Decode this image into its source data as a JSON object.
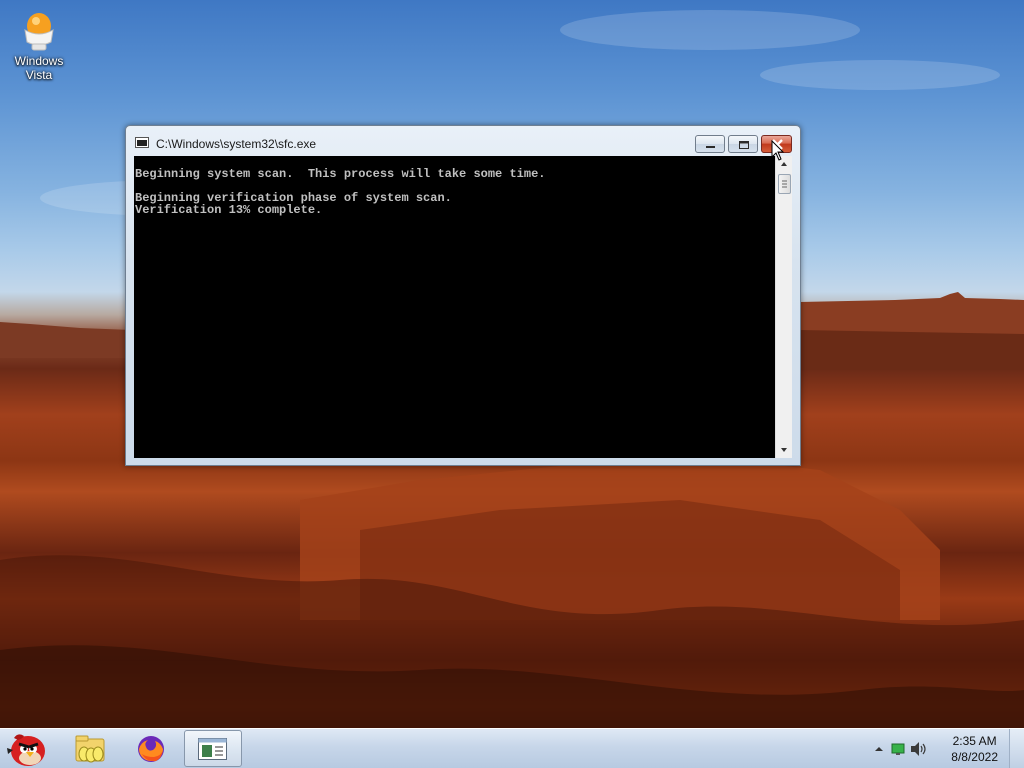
{
  "desktop": {
    "icons": [
      {
        "label": "Windows Vista"
      }
    ]
  },
  "console_window": {
    "title": "C:\\Windows\\system32\\sfc.exe",
    "lines": [
      "Beginning system scan.  This process will take some time.",
      "",
      "Beginning verification phase of system scan.",
      "Verification 13% complete."
    ],
    "verification_progress_percent": 13,
    "text_color": "#c0c0c0",
    "background_color": "#000000"
  },
  "taskbar": {
    "buttons": [
      {
        "icon": "angry-bird-start-icon"
      },
      {
        "icon": "folder-eggs-icon"
      },
      {
        "icon": "firefox-icon"
      },
      {
        "icon": "console-window-icon",
        "active": true
      }
    ],
    "tray": {
      "icons": [
        "show-hidden-icons-arrow-icon",
        "network-icon",
        "speaker-icon"
      ],
      "time": "2:35 AM",
      "date": "8/8/2022"
    }
  },
  "colors": {
    "close_button": "#c0391d",
    "title_bar": "#d7e3ef",
    "taskbar": "#c7d6e9"
  }
}
